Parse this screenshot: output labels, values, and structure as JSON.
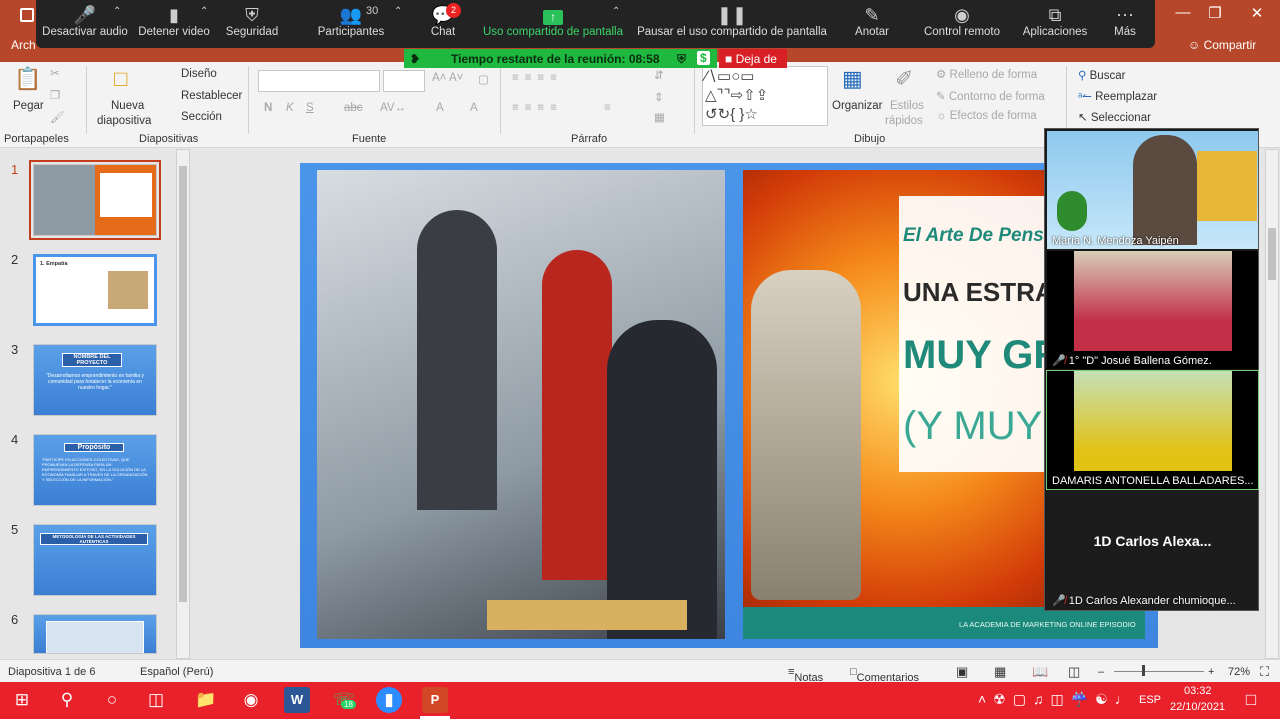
{
  "window": {
    "file_menu": "Arch",
    "share_label": "Compartir"
  },
  "zoom_toolbar": {
    "mute": "Desactivar audio",
    "video": "Detener video",
    "security": "Seguridad",
    "participants": "Participantes",
    "participants_count": "30",
    "chat": "Chat",
    "chat_badge": "2",
    "screen_share": "Uso compartido de pantalla",
    "pause_share": "Pausar el uso compartido de pantalla",
    "annotate": "Anotar",
    "remote_control": "Control remoto",
    "apps": "Aplicaciones",
    "more": "Más"
  },
  "meeting": {
    "time_remaining": "Tiempo restante de la reunión: 08:58",
    "leave": "Deja de"
  },
  "ribbon": {
    "paste": "Pegar",
    "clipboard": "Portapapeles",
    "new_slide_line1": "Nueva",
    "new_slide_line2": "diapositiva",
    "layout": "Diseño",
    "reset": "Restablecer",
    "section": "Sección",
    "slides_group": "Diapositivas",
    "font_group": "Fuente",
    "paragraph_group": "Párrafo",
    "drawing_group": "Dibujo",
    "arrange": "Organizar",
    "quick_styles_line1": "Estilos",
    "quick_styles_line2": "rápidos",
    "shape_fill": "Relleno de forma",
    "shape_outline": "Contorno de forma",
    "shape_effects": "Efectos de forma",
    "find": "Buscar",
    "replace": "Reemplazar",
    "select": "Seleccionar",
    "bold": "N",
    "italic": "K",
    "underline": "S",
    "strike": "abc"
  },
  "thumbnails": [
    {
      "num": "1"
    },
    {
      "num": "2",
      "title": "1. Empatía"
    },
    {
      "num": "3",
      "title": "NOMBRE DEL PROYECTO",
      "body": "“Desarrollamos emprendimiento en familia y comunidad para fortalecer la economía en nuestro hogar.”"
    },
    {
      "num": "4",
      "title": "Propósito",
      "body": "“PARTICIPE EN ACCIONES COLECTIVAS, QUE PROMUEVAN LA DEFENSA PARA UN EMPRENDIMIENTO EXITOSO, EN LA SOLUCIÓN DE LA ECONOMÍA FAMILIAR A TRAVÉS DE LA ORGANIZACIÓN Y SELECCIÓN DE LA INFORMACIÓN.”"
    },
    {
      "num": "5",
      "title": "METODOLOGÍA DE LAS ACTIVIDADES AUTÉNTICAS"
    },
    {
      "num": "6"
    }
  ],
  "slide": {
    "right_title1": "El Arte De Pensar E",
    "right_title2": "UNA ESTRATEGIA D",
    "right_title3": "MUY GRATIF",
    "right_title4": "(Y MUY REN",
    "right_footer": "LA ACADEMIA DE MARKETING ONLINE EPISODIO"
  },
  "participants": [
    {
      "name": "María N. Mendoza Yaipén",
      "muted": false
    },
    {
      "name": "1° \"D\" Josué Ballena Gómez.",
      "muted": true
    },
    {
      "name": "DAMARIS ANTONELLA BALLADARES...",
      "muted": false
    },
    {
      "name": "1D Carlos Alexander chumioque...",
      "muted": true,
      "display": "1D Carlos Alexa..."
    }
  ],
  "status": {
    "slide_info": "Diapositiva 1 de 6",
    "language": "Español (Perú)",
    "notes": "Notas",
    "comments": "Comentarios",
    "zoom": "72%"
  },
  "taskbar": {
    "whatsapp_badge": "18",
    "language": "ESP",
    "time": "03:32",
    "date": "22/10/2021"
  }
}
